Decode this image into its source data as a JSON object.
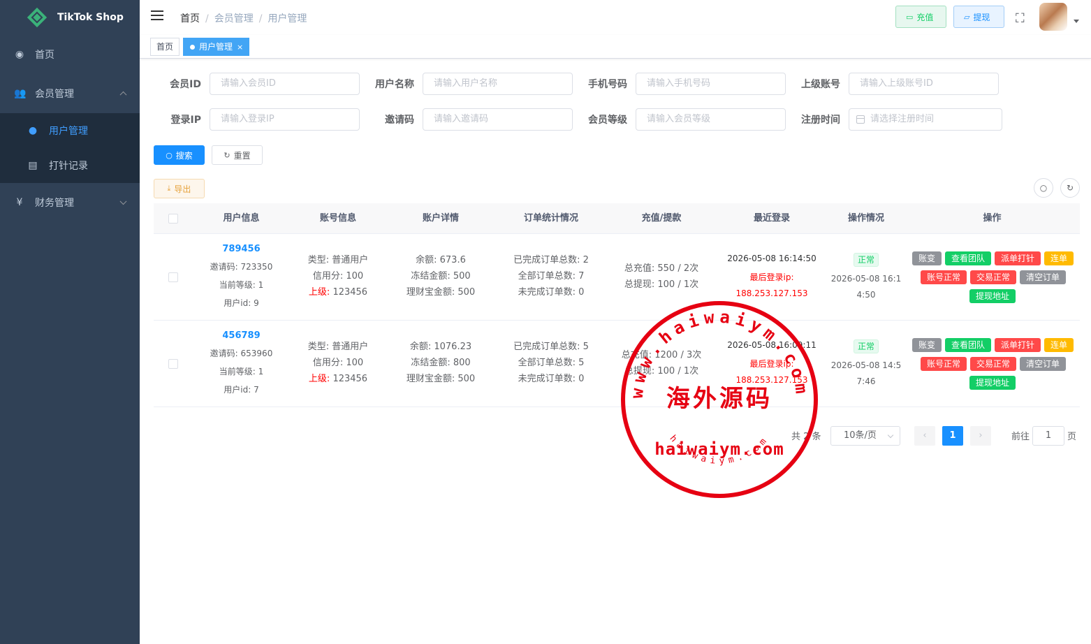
{
  "app": {
    "title": "TikTok Shop"
  },
  "sidebar": {
    "home": "首页",
    "member": "会员管理",
    "user_manage": "用户管理",
    "punch_record": "打针记录",
    "finance": "财务管理"
  },
  "breadcrumb": [
    "首页",
    "会员管理",
    "用户管理"
  ],
  "header": {
    "recharge": "充值",
    "withdraw": "提现"
  },
  "tags": {
    "home": "首页",
    "active": "用户管理",
    "close": "×"
  },
  "search": {
    "member_id": {
      "label": "会员ID",
      "placeholder": "请输入会员ID"
    },
    "username": {
      "label": "用户名称",
      "placeholder": "请输入用户名称"
    },
    "phone": {
      "label": "手机号码",
      "placeholder": "请输入手机号码"
    },
    "parent": {
      "label": "上级账号",
      "placeholder": "请输入上级账号ID"
    },
    "login_ip": {
      "label": "登录IP",
      "placeholder": "请输入登录IP"
    },
    "invite": {
      "label": "邀请码",
      "placeholder": "请输入邀请码"
    },
    "level": {
      "label": "会员等级",
      "placeholder": "请输入会员等级"
    },
    "reg_time": {
      "label": "注册时间",
      "placeholder": "请选择注册时间"
    },
    "search_btn": "搜索",
    "reset_btn": "重置",
    "export_btn": "导出"
  },
  "table": {
    "headers": [
      "用户信息",
      "账号信息",
      "账户详情",
      "订单统计情况",
      "充值/提款",
      "最近登录",
      "操作情况",
      "操作"
    ],
    "rows": [
      {
        "uid": "789456",
        "invite": "邀请码: 723350",
        "level": "当前等级: 1",
        "user_id": "用户id: 9",
        "type": "类型: 普通用户",
        "credit": "信用分: 100",
        "parent_label": "上级:",
        "parent_value": " 123456",
        "balance": "余额: 673.6",
        "frozen": "冻结金额: 500",
        "wealth": "理财宝金额: 500",
        "done": "已完成订单总数: 2",
        "all": "全部订单总数: 7",
        "undone": "未完成订单数: 0",
        "total_recharge": "总充值: 550 / 2次",
        "total_withdraw": "总提现: 100 / 1次",
        "login_time": "2026-05-08 16:14:50",
        "ip_label": "最后登录ip:",
        "ip": "188.253.127.153",
        "status": "正常",
        "op_time_1": "2026-05-08 16:1",
        "op_time_2": "4:50"
      },
      {
        "uid": "456789",
        "invite": "邀请码: 653960",
        "level": "当前等级: 1",
        "user_id": "用户id: 7",
        "type": "类型: 普通用户",
        "credit": "信用分: 100",
        "parent_label": "上级:",
        "parent_value": " 123456",
        "balance": "余额: 1076.23",
        "frozen": "冻结金额: 800",
        "wealth": "理财宝金额: 500",
        "done": "已完成订单总数: 5",
        "all": "全部订单总数: 5",
        "undone": "未完成订单数: 0",
        "total_recharge": "总充值: 1200 / 3次",
        "total_withdraw": "总提现: 100 / 1次",
        "login_time": "2026-05-08 16:09:11",
        "ip_label": "最后登录ip:",
        "ip": "188.253.127.153",
        "status": "正常",
        "op_time_1": "2026-05-08 14:5",
        "op_time_2": "7:46"
      }
    ],
    "ops": {
      "account_change": "账变",
      "view_team": "查看团队",
      "assign_punch": "派单打针",
      "chain": "连单",
      "account_normal": "账号正常",
      "trade_normal": "交易正常",
      "clear_orders": "清空订单",
      "withdraw_address": "提现地址"
    }
  },
  "pagination": {
    "total": "共 2 条",
    "page_size": "10条/页",
    "current": "1",
    "goto": "前往",
    "goto_value": "1",
    "page_unit": "页"
  },
  "watermark": {
    "top_arc": "www.haiwaiym.com",
    "center": "海外源码",
    "domain": "haiwaiym.com",
    "bottom_arc": "haiwaiym.com"
  },
  "colors": {
    "sidebar_bg": "#304156",
    "primary": "#1890ff",
    "success": "#13ce66",
    "danger": "#ff4949",
    "warning": "#ffba00"
  }
}
